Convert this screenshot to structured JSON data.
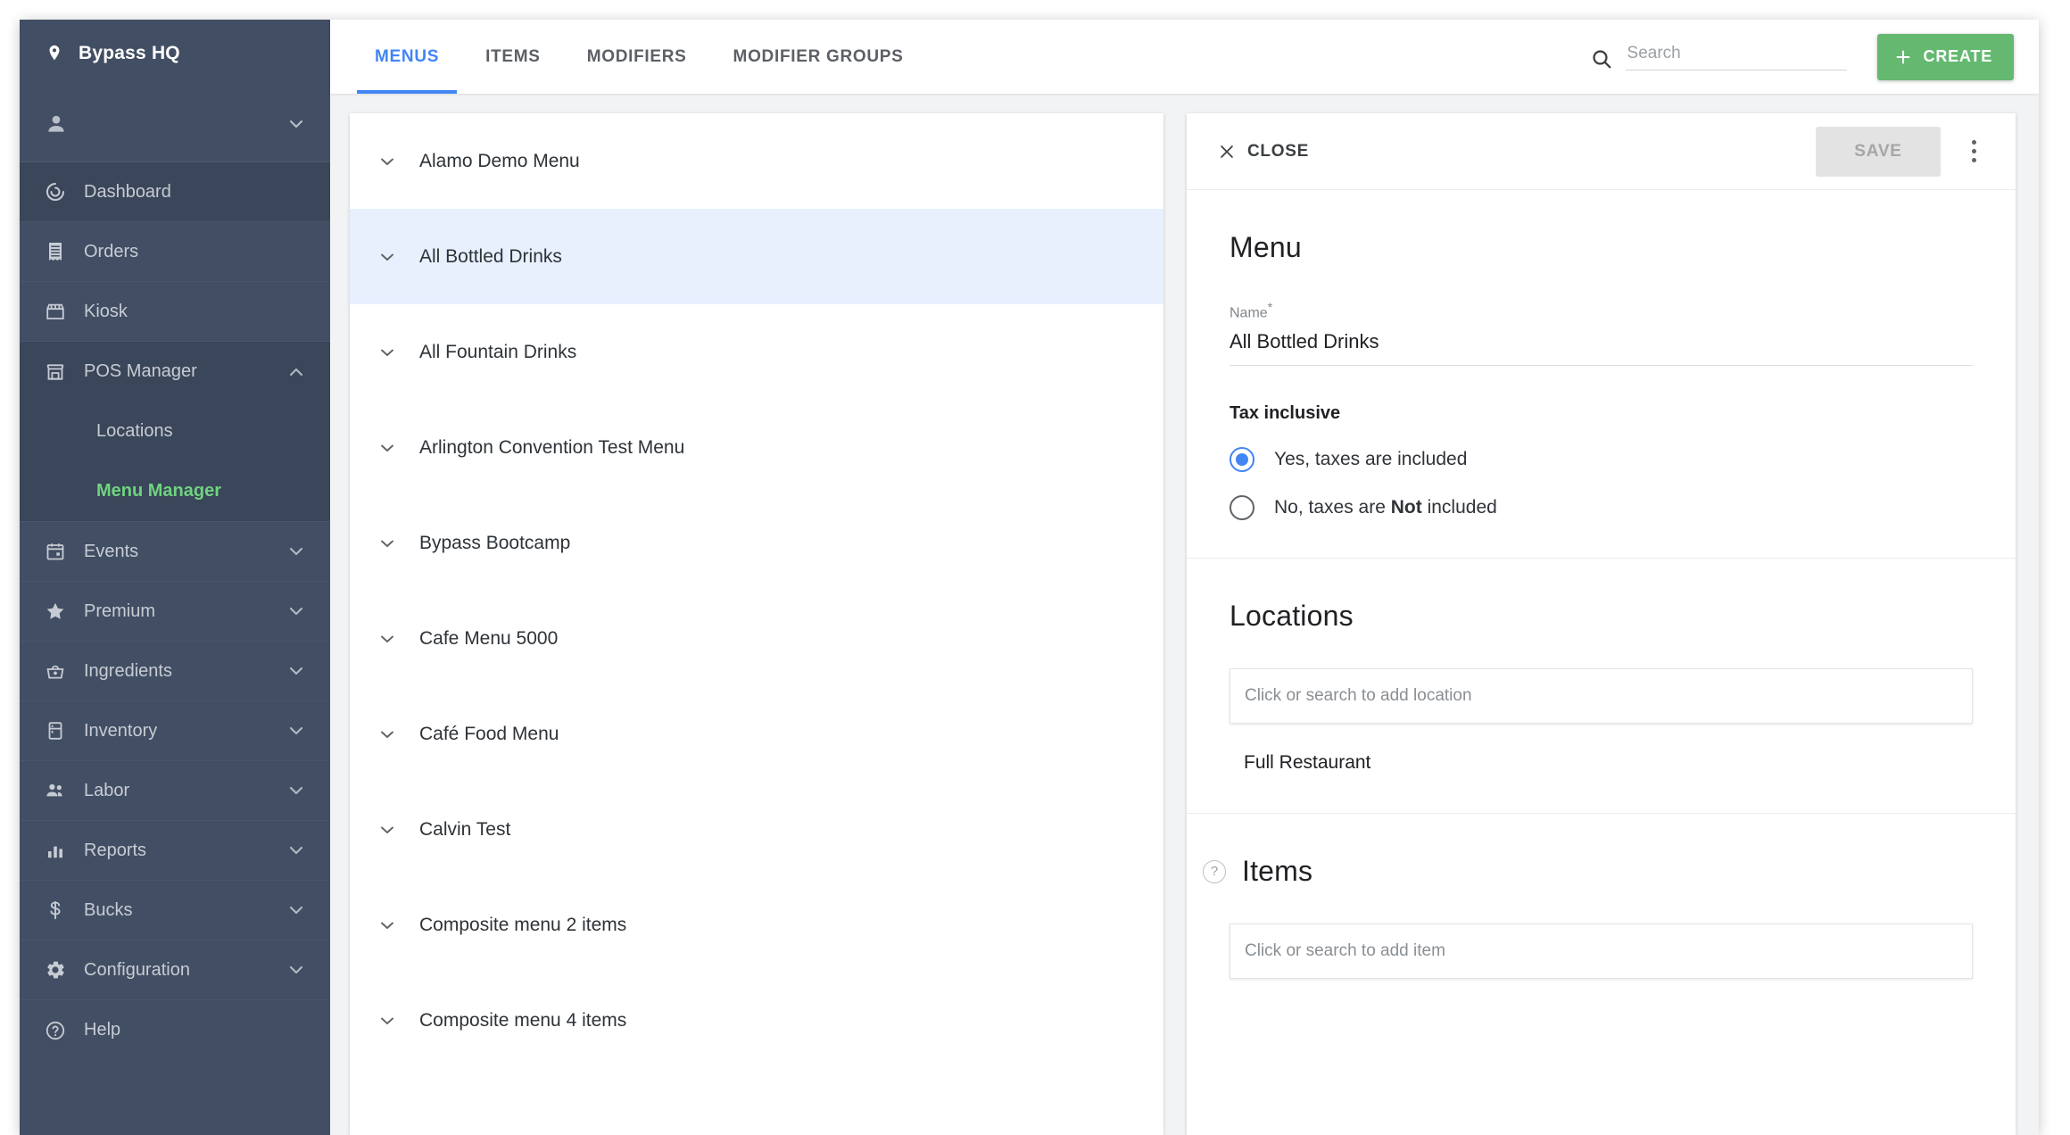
{
  "sidebar": {
    "brand": {
      "name": "Bypass HQ",
      "icon": "location-pin-icon"
    },
    "user": {
      "icon": "person-icon",
      "chevron": "chevron-down-icon"
    },
    "items": [
      {
        "label": "Dashboard",
        "icon": "dashboard-icon",
        "expandable": false,
        "active": true
      },
      {
        "label": "Orders",
        "icon": "receipt-icon",
        "expandable": false
      },
      {
        "label": "Kiosk",
        "icon": "storefront-icon",
        "expandable": false
      },
      {
        "label": "POS Manager",
        "icon": "store-icon",
        "expandable": true,
        "expanded": true,
        "chevron": "chevron-up-icon"
      },
      {
        "label": "Events",
        "icon": "calendar-icon",
        "expandable": true,
        "chevron": "chevron-down-icon"
      },
      {
        "label": "Premium",
        "icon": "star-icon",
        "expandable": true,
        "chevron": "chevron-down-icon"
      },
      {
        "label": "Ingredients",
        "icon": "basket-icon",
        "expandable": true,
        "chevron": "chevron-down-icon"
      },
      {
        "label": "Inventory",
        "icon": "fridge-icon",
        "expandable": true,
        "chevron": "chevron-down-icon"
      },
      {
        "label": "Labor",
        "icon": "people-icon",
        "expandable": true,
        "chevron": "chevron-down-icon"
      },
      {
        "label": "Reports",
        "icon": "bar-chart-icon",
        "expandable": true,
        "chevron": "chevron-down-icon"
      },
      {
        "label": "Bucks",
        "icon": "dollar-icon",
        "expandable": true,
        "chevron": "chevron-down-icon"
      },
      {
        "label": "Configuration",
        "icon": "gear-icon",
        "expandable": true,
        "chevron": "chevron-down-icon"
      },
      {
        "label": "Help",
        "icon": "help-circle-icon",
        "expandable": false
      }
    ],
    "pos_manager_subitems": [
      {
        "label": "Locations",
        "current": false
      },
      {
        "label": "Menu Manager",
        "current": true
      }
    ]
  },
  "topbar": {
    "tabs": [
      {
        "label": "MENUS",
        "active": true
      },
      {
        "label": "ITEMS",
        "active": false
      },
      {
        "label": "MODIFIERS",
        "active": false
      },
      {
        "label": "MODIFIER GROUPS",
        "active": false
      }
    ],
    "search": {
      "placeholder": "Search",
      "value": "",
      "icon": "search-icon"
    },
    "create_label": "CREATE",
    "create_icon": "plus-icon"
  },
  "menu_list": {
    "rows": [
      {
        "label": "Alamo Demo Menu",
        "selected": false
      },
      {
        "label": "All Bottled Drinks",
        "selected": true
      },
      {
        "label": "All Fountain Drinks",
        "selected": false
      },
      {
        "label": "Arlington Convention Test Menu",
        "selected": false
      },
      {
        "label": "Bypass Bootcamp",
        "selected": false
      },
      {
        "label": "Cafe Menu 5000",
        "selected": false
      },
      {
        "label": "Café Food Menu",
        "selected": false
      },
      {
        "label": "Calvin Test",
        "selected": false
      },
      {
        "label": "Composite menu 2 items",
        "selected": false
      },
      {
        "label": "Composite menu 4 items",
        "selected": false
      }
    ]
  },
  "detail": {
    "close_label": "CLOSE",
    "close_icon": "close-icon",
    "save_label": "SAVE",
    "more_icon": "kebab-menu-icon",
    "menu_section": {
      "title": "Menu",
      "name_label": "Name",
      "name_required_marker": "*",
      "name_value": "All Bottled Drinks",
      "tax_group_label": "Tax inclusive",
      "tax_options": [
        {
          "text_before": "Yes, taxes are included",
          "bold": "",
          "text_after": "",
          "selected": true
        },
        {
          "text_before": "No, taxes are ",
          "bold": "Not",
          "text_after": " included",
          "selected": false
        }
      ]
    },
    "locations_section": {
      "title": "Locations",
      "picker_placeholder": "Click or search to add location",
      "entries": [
        "Full Restaurant"
      ]
    },
    "items_section": {
      "title": "Items",
      "help_icon": "help-circle-icon",
      "help_glyph": "?",
      "picker_placeholder": "Click or search to add item"
    }
  },
  "colors": {
    "sidebar_bg": "#414e63",
    "accent_blue": "#4285f4",
    "accent_green": "#64b870",
    "active_green_text": "#6fd37f",
    "selected_row": "#e8f0fe",
    "page_bg": "#f2f3f5"
  }
}
